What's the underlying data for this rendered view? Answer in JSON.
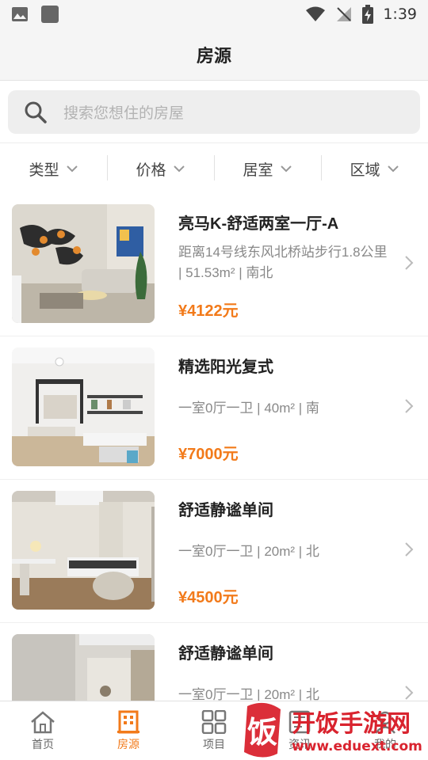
{
  "status_bar": {
    "time": "1:39",
    "left_icons": [
      "image-icon",
      "square-app-icon"
    ],
    "right_icons": [
      "wifi-icon",
      "no-signal-icon",
      "battery-charging-icon"
    ]
  },
  "header": {
    "title": "房源"
  },
  "search": {
    "placeholder": "搜索您想住的房屋"
  },
  "filters": [
    {
      "label": "类型"
    },
    {
      "label": "价格"
    },
    {
      "label": "居室"
    },
    {
      "label": "区域"
    }
  ],
  "listings": [
    {
      "title": "亮马K-舒适两室一厅-A",
      "desc": "距离14号线东风北桥站步行1.8公里 | 51.53m² | 南北",
      "price": "¥4122元"
    },
    {
      "title": "精选阳光复式",
      "desc": "一室0厅一卫 | 40m² | 南",
      "price": "¥7000元"
    },
    {
      "title": "舒适静谧单间",
      "desc": "一室0厅一卫 | 20m² | 北",
      "price": "¥4500元"
    },
    {
      "title": "舒适静谧单间",
      "desc": "一室0厅一卫 | 20m² | 北",
      "price": ""
    }
  ],
  "tabbar": [
    {
      "label": "首页",
      "icon": "home-icon"
    },
    {
      "label": "房源",
      "icon": "building-icon",
      "active": true
    },
    {
      "label": "项目",
      "icon": "grid-icon"
    },
    {
      "label": "资讯",
      "icon": "news-icon"
    },
    {
      "label": "我的",
      "icon": "user-icon"
    }
  ],
  "watermark": {
    "brand": "饭",
    "site_name": "开饭手游网",
    "url": "www.eduext.com"
  },
  "colors": {
    "accent": "#f27a1a",
    "watermark_red": "#d9232e",
    "background": "#f5f5f5"
  }
}
